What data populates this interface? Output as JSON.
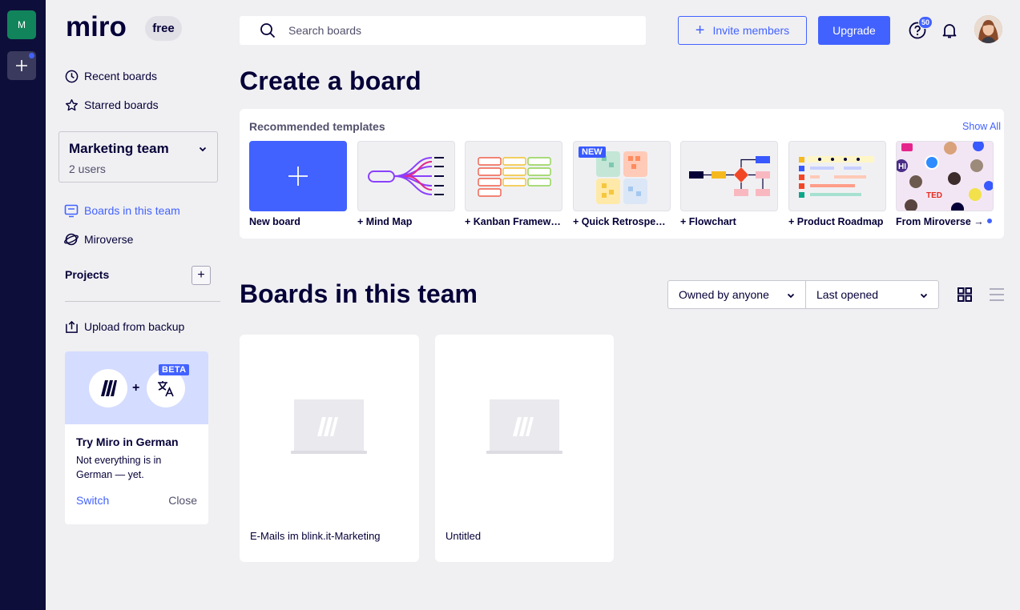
{
  "rail": {
    "team_initial": "M"
  },
  "brand": {
    "logo_text": "miro",
    "plan_badge": "free"
  },
  "sidebar": {
    "nav": [
      {
        "label": "Recent boards",
        "icon": "clock-icon"
      },
      {
        "label": "Starred boards",
        "icon": "star-icon"
      }
    ],
    "team": {
      "name": "Marketing team",
      "users": "2 users"
    },
    "team_nav": [
      {
        "label": "Boards in this team",
        "icon": "board-icon",
        "active": true
      },
      {
        "label": "Miroverse",
        "icon": "miroverse-icon",
        "active": false
      }
    ],
    "projects_label": "Projects",
    "projects_add": "+",
    "upload_label": "Upload from backup",
    "promo": {
      "badge": "BETA",
      "plus": "+",
      "title": "Try Miro in German",
      "text": "Not everything is in German — yet.",
      "switch": "Switch",
      "close": "Close"
    }
  },
  "header": {
    "search_placeholder": "Search boards",
    "invite_label": "Invite members",
    "invite_plus": "+",
    "upgrade_label": "Upgrade",
    "help_badge": "50"
  },
  "create": {
    "title": "Create a board",
    "recommended_label": "Recommended templates",
    "show_all": "Show All",
    "new_badge": "NEW",
    "templates": [
      {
        "label": "New board"
      },
      {
        "label": "+ Mind Map"
      },
      {
        "label": "+ Kanban Framework"
      },
      {
        "label": "+ Quick Retrospective"
      },
      {
        "label": "+ Flowchart"
      },
      {
        "label": "+ Product Roadmap"
      },
      {
        "label": "From Miroverse →"
      }
    ],
    "miroverse_tags": {
      "ted": "TED",
      "hi": "HI"
    }
  },
  "boards": {
    "title": "Boards in this team",
    "filter_owner": "Owned by anyone",
    "sort": "Last opened",
    "items": [
      {
        "name": "E-Mails im blink.it-Marketing"
      },
      {
        "name": "Untitled"
      }
    ]
  },
  "colors": {
    "accent": "#4262ff",
    "rail": "#0e0e3a",
    "team_avatar": "#11845b",
    "background": "#f0f0f3"
  }
}
